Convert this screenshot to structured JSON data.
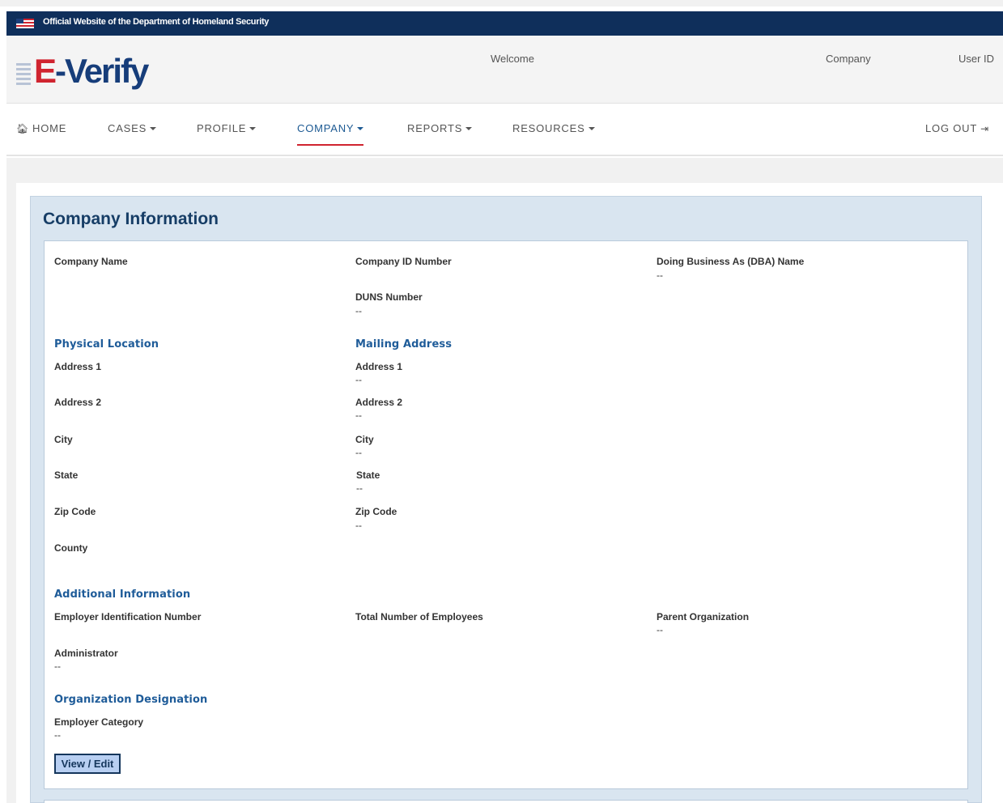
{
  "gov_banner": {
    "text": "Official Website of the Department of Homeland Security"
  },
  "brand": {
    "logo_e": "E",
    "logo_verify": "-Verify",
    "welcome": "Welcome",
    "company": "Company",
    "user_id": "User ID"
  },
  "nav": {
    "home": "HOME",
    "cases": "CASES",
    "profile": "PROFILE",
    "company": "COMPANY",
    "reports": "REPORTS",
    "resources": "RESOURCES",
    "logout": "LOG OUT"
  },
  "colors": {
    "gov_bar": "#0f2f5b",
    "accent_red": "#d0242f",
    "section_blue": "#1f5c99",
    "panel_bg": "#d9e5f0"
  },
  "panel": {
    "title": "Company Information"
  },
  "company": {
    "company_name_label": "Company Name",
    "company_id_label": "Company ID Number",
    "dba_label": "Doing Business As (DBA) Name",
    "dba_value": "--",
    "duns_label": "DUNS Number",
    "duns_value": "--"
  },
  "physical": {
    "heading": "Physical Location",
    "address1_label": "Address 1",
    "address2_label": "Address 2",
    "city_label": "City",
    "state_label": "State",
    "zip_label": "Zip Code",
    "county_label": "County"
  },
  "mailing": {
    "heading": "Mailing Address",
    "address1_label": "Address 1",
    "address1_value": "--",
    "address2_label": "Address 2",
    "address2_value": "--",
    "city_label": "City",
    "city_value": "--",
    "state_label": "State",
    "state_value": "--",
    "zip_label": "Zip Code",
    "zip_value": "--"
  },
  "additional": {
    "heading": "Additional Information",
    "ein_label": "Employer Identification Number",
    "employees_label": "Total Number of Employees",
    "parent_label": "Parent Organization",
    "parent_value": "--",
    "admin_label": "Administrator",
    "admin_value": "--"
  },
  "designation": {
    "heading": "Organization Designation",
    "category_label": "Employer Category",
    "category_value": "--"
  },
  "actions": {
    "view_edit": "View / Edit"
  }
}
